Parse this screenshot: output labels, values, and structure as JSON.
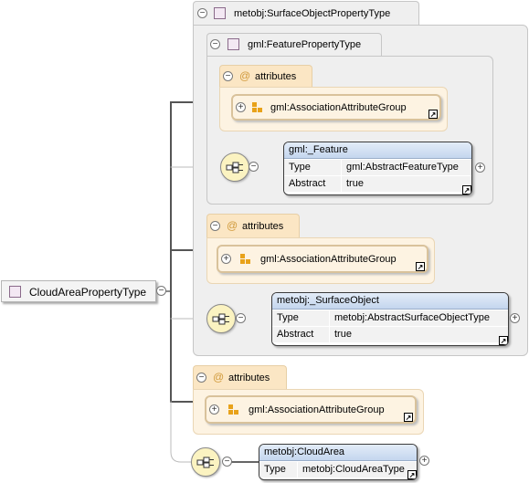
{
  "root": {
    "label": "CloudAreaPropertyType"
  },
  "outer_extension": {
    "label": "metobj:SurfaceObjectPropertyType"
  },
  "inner_extension": {
    "label": "gml:FeaturePropertyType"
  },
  "attributes_label": "attributes",
  "attribute_group": "gml:AssociationAttributeGroup",
  "elements": {
    "feature": {
      "name": "gml:_Feature",
      "rows": [
        {
          "k": "Type",
          "v": "gml:AbstractFeatureType"
        },
        {
          "k": "Abstract",
          "v": "true"
        }
      ]
    },
    "surface_object": {
      "name": "metobj:_SurfaceObject",
      "rows": [
        {
          "k": "Type",
          "v": "metobj:AbstractSurfaceObjectType"
        },
        {
          "k": "Abstract",
          "v": "true"
        }
      ]
    },
    "cloud_area": {
      "name": "metobj:CloudArea",
      "rows": [
        {
          "k": "Type",
          "v": "metobj:CloudAreaType"
        }
      ]
    }
  },
  "toggle_symbols": {
    "collapse": "−",
    "expand": "+"
  },
  "jump_symbol": "↗",
  "icons": [
    "complex-type-icon",
    "attributes-at-icon",
    "attribute-group-icon",
    "sequence-icon",
    "jump-icon"
  ]
}
